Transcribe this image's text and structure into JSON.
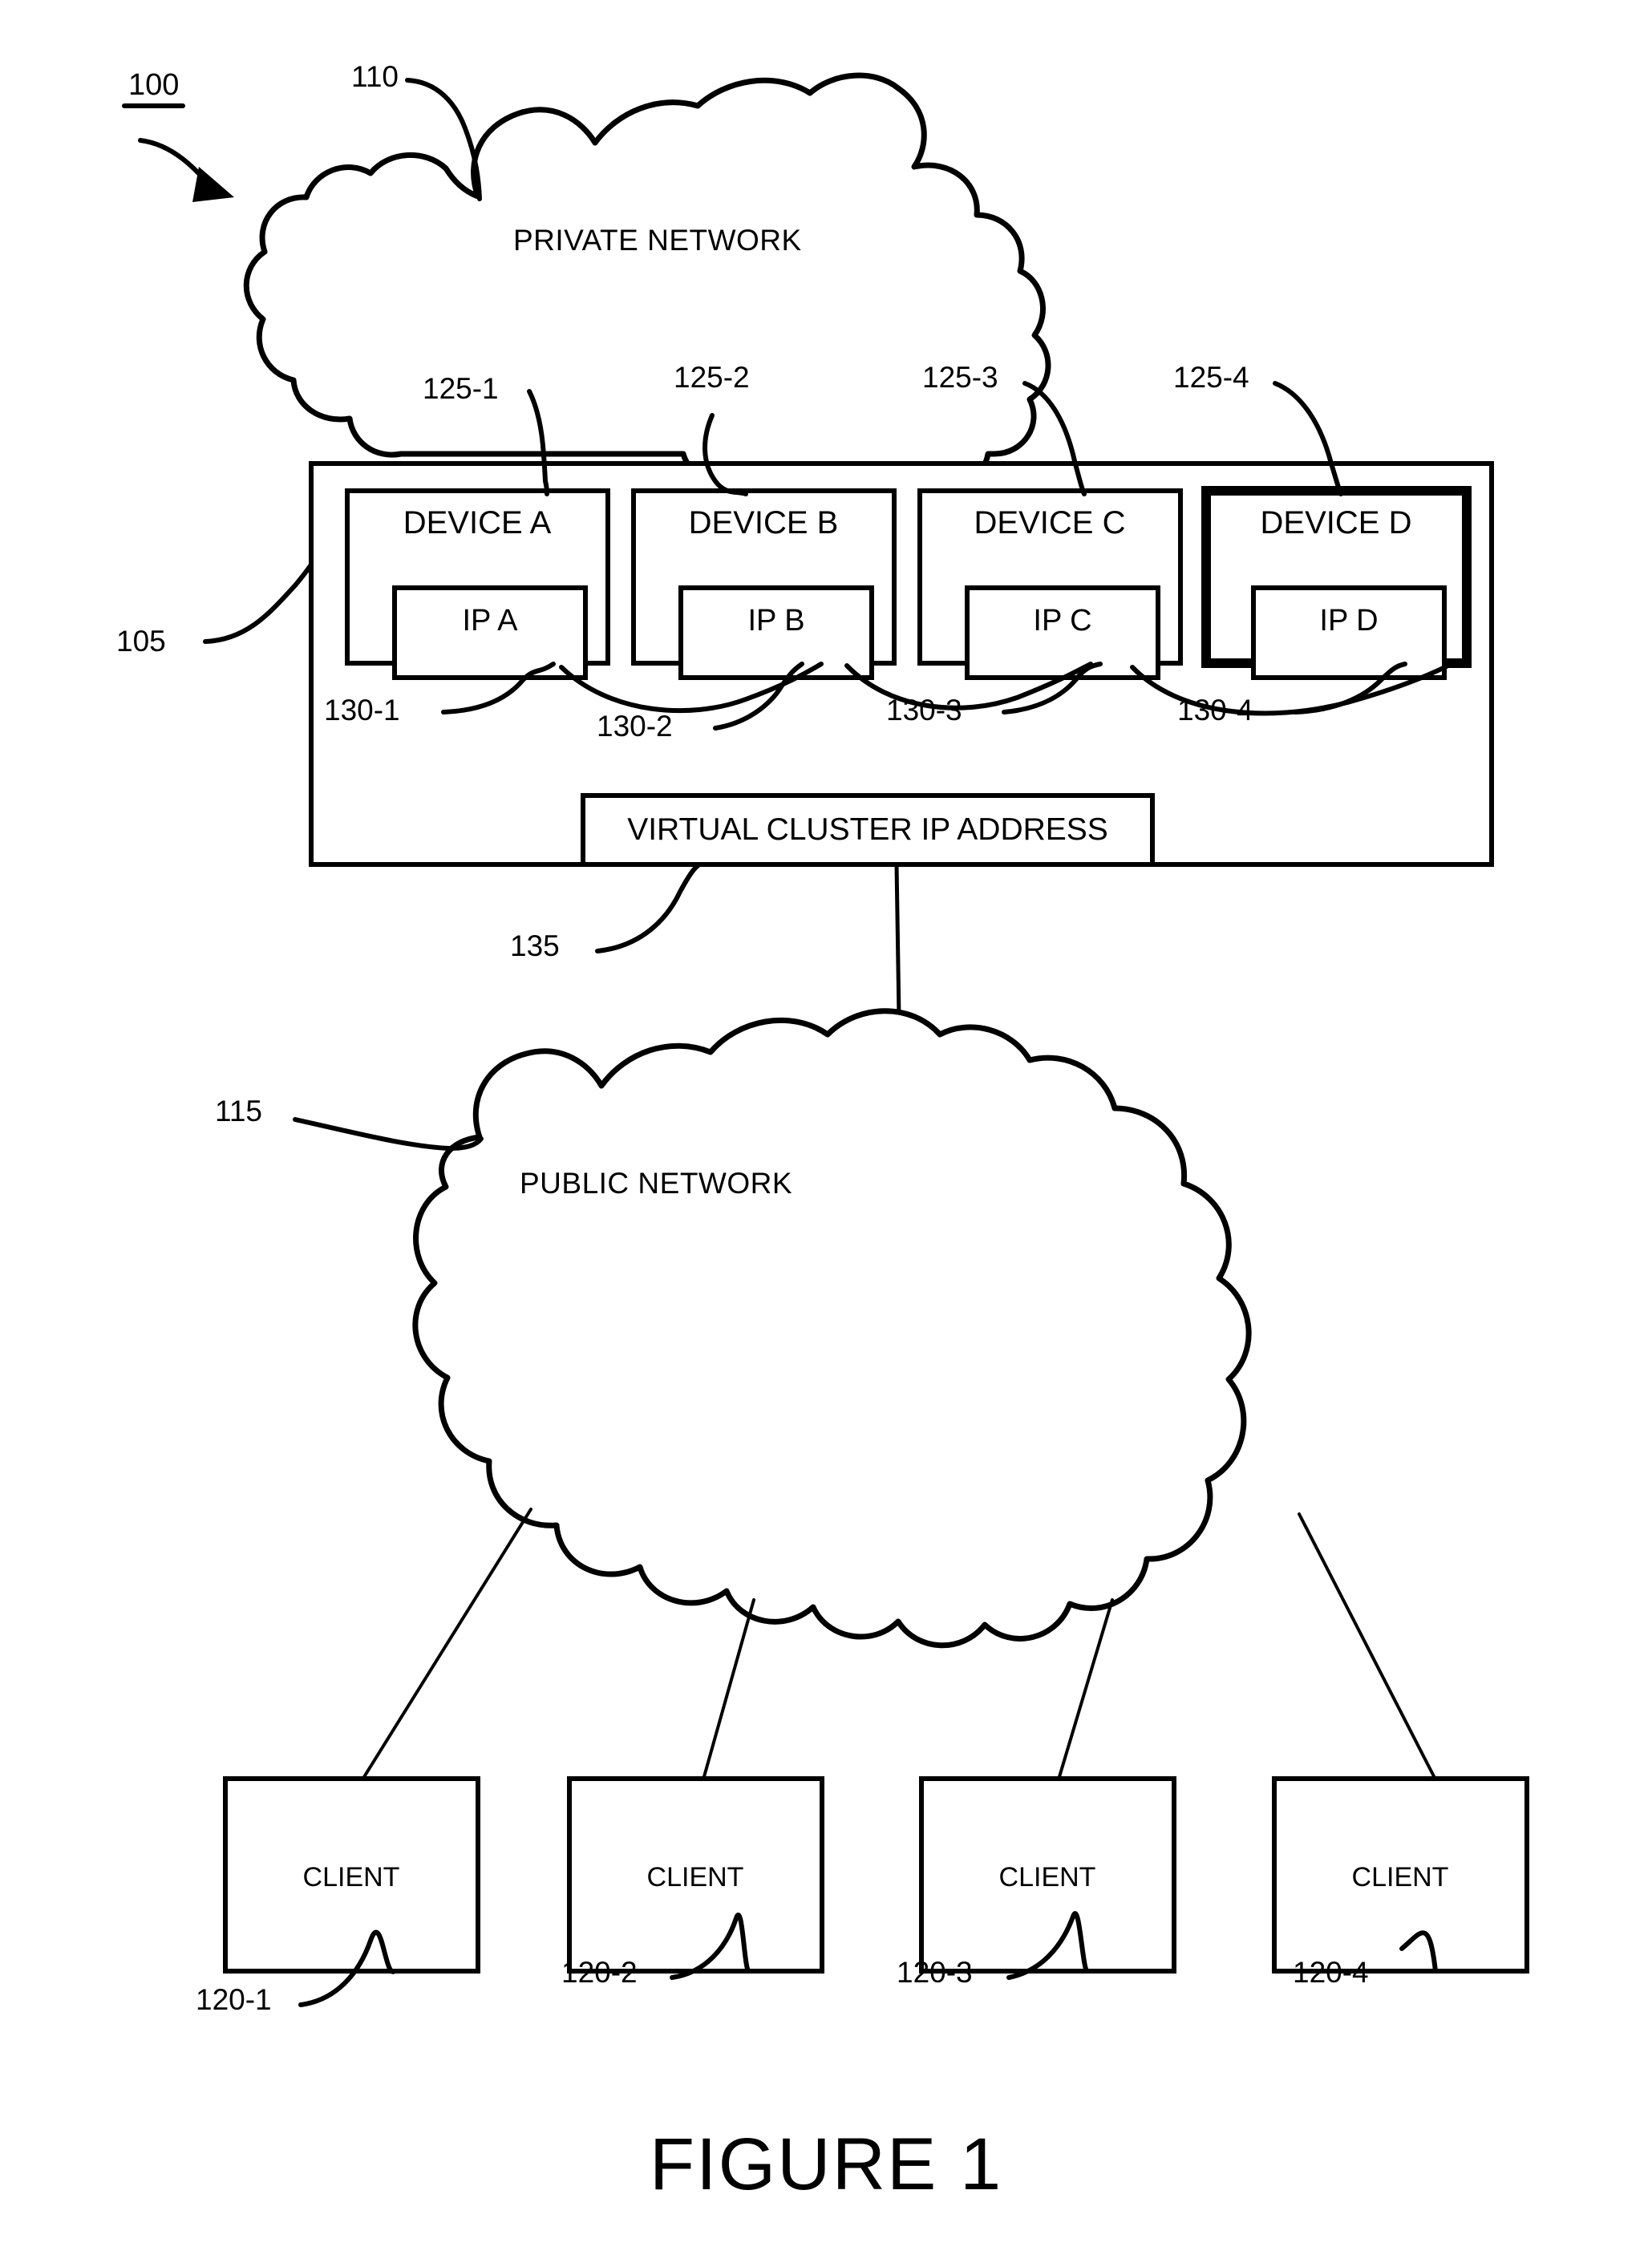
{
  "figure": {
    "caption": "FIGURE  1",
    "system_ref": "100"
  },
  "networks": [
    {
      "id": "private",
      "label": "PRIVATE NETWORK",
      "ref": "110"
    },
    {
      "id": "public",
      "label": "PUBLIC NETWORK",
      "ref": "115"
    }
  ],
  "cluster": {
    "ref": "105",
    "virtual_ip": {
      "label": "VIRTUAL CLUSTER IP ADDRESS",
      "ref": "135"
    },
    "devices": [
      {
        "label": "DEVICE A",
        "ref": "125-1",
        "ip_label": "IP A",
        "ip_ref": "130-1",
        "highlighted": false
      },
      {
        "label": "DEVICE B",
        "ref": "125-2",
        "ip_label": "IP B",
        "ip_ref": "130-2",
        "highlighted": false
      },
      {
        "label": "DEVICE C",
        "ref": "125-3",
        "ip_label": "IP C",
        "ip_ref": "130-3",
        "highlighted": false
      },
      {
        "label": "DEVICE D",
        "ref": "125-4",
        "ip_label": "IP D",
        "ip_ref": "130-4",
        "highlighted": true
      }
    ]
  },
  "clients": [
    {
      "label": "CLIENT",
      "ref": "120-1"
    },
    {
      "label": "CLIENT",
      "ref": "120-2"
    },
    {
      "label": "CLIENT",
      "ref": "120-3"
    },
    {
      "label": "CLIENT",
      "ref": "120-4"
    }
  ],
  "colors": {
    "ink": "#000000",
    "paper": "#ffffff"
  }
}
